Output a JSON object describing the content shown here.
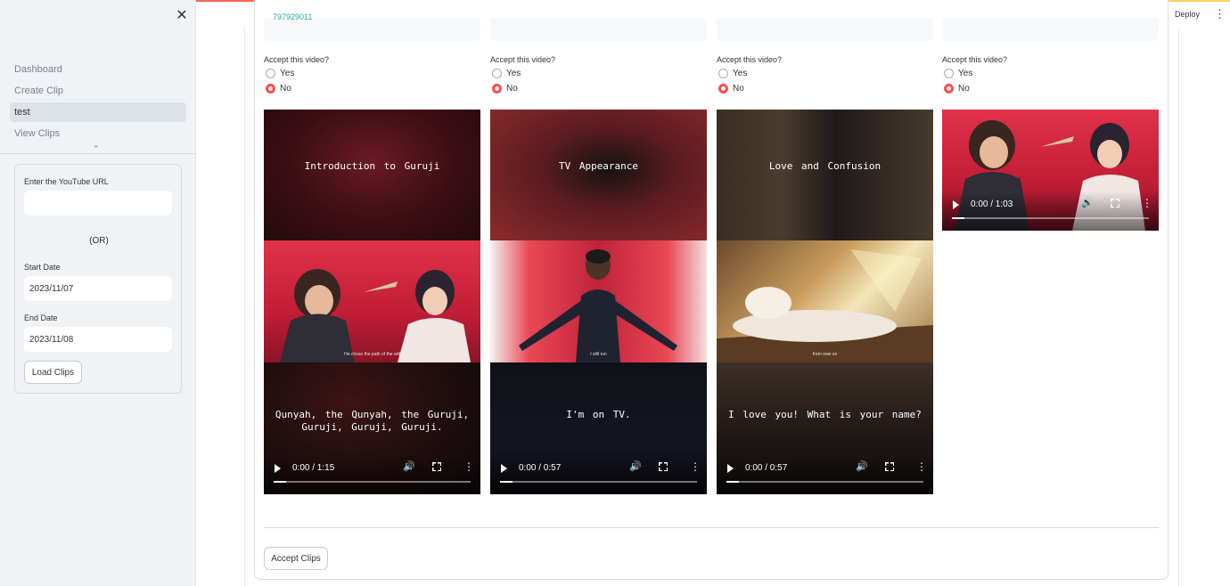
{
  "sidebar": {
    "nav": [
      {
        "label": "Dashboard",
        "active": false
      },
      {
        "label": "Create Clip",
        "active": false
      },
      {
        "label": "test",
        "active": true
      },
      {
        "label": "View Clips",
        "active": false
      }
    ],
    "form": {
      "url_label": "Enter the YouTube URL",
      "url_value": "",
      "or_text": "(OR)",
      "start_label": "Start Date",
      "start_value": "2023/11/07",
      "end_label": "End Date",
      "end_value": "2023/11/08",
      "load_button": "Load Clips"
    }
  },
  "header": {
    "deploy_label": "Deploy"
  },
  "main": {
    "partial_text": "797929011",
    "question": "Accept this video?",
    "option_yes": "Yes",
    "option_no": "No",
    "clips": [
      {
        "title": "Introduction to Guruji",
        "caption": "He chose the path of the will",
        "subtitle": "Qunyah, the Qunyah, the Guruji, Guruji, Guruji, Guruji.",
        "time": "0:00 / 1:15",
        "accepted": false
      },
      {
        "title": "TV Appearance",
        "caption": "I still run",
        "subtitle": "I'm on TV.",
        "time": "0:00 / 0:57",
        "accepted": false
      },
      {
        "title": "Love and Confusion",
        "caption": "from now on",
        "subtitle": "I love you! What is your name?",
        "time": "0:00 / 0:57",
        "accepted": false
      },
      {
        "title": "",
        "caption": "",
        "subtitle": "",
        "time": "0:00 / 1:03",
        "accepted": false
      }
    ],
    "accept_button": "Accept Clips"
  },
  "colors": {
    "accent": "#ff4b4b",
    "sidebar_bg": "#f0f2f6",
    "link": "#2aa8a0"
  }
}
